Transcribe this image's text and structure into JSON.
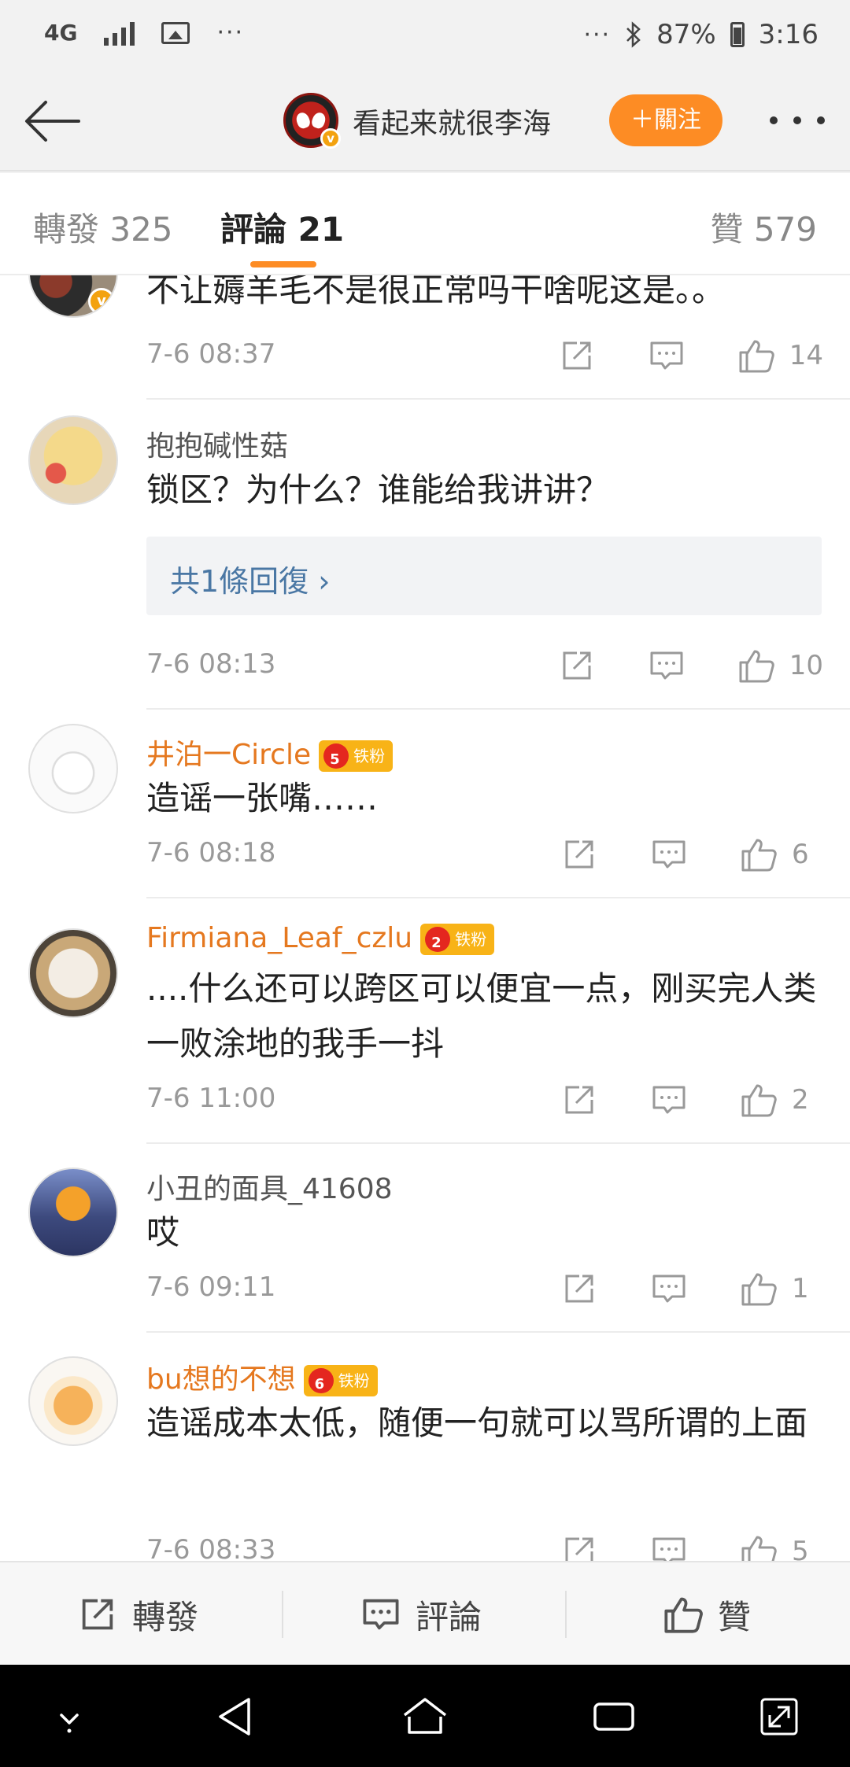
{
  "status_bar": {
    "network": "4G",
    "battery": "87%",
    "time": "3:16",
    "dots": "···"
  },
  "header": {
    "title": "看起来就很李海",
    "follow_label": "＋關注"
  },
  "tabs": [
    {
      "label": "轉發 325"
    },
    {
      "label": "評論 21"
    },
    {
      "label": "贊 579"
    }
  ],
  "comments": [
    {
      "text": "不让薅羊毛不是很正常吗干啥呢这是。。",
      "time": "7-6 08:37",
      "likes": "14"
    },
    {
      "name": "抱抱碱性菇",
      "text": "锁区？为什么？谁能给我讲讲？",
      "reply": "共1條回復 ›",
      "time": "7-6 08:13",
      "likes": "10"
    },
    {
      "name": "井泊一Circle",
      "badge": "铁粉",
      "badge_level": "5",
      "text": "造谣一张嘴……",
      "time": "7-6 08:18",
      "likes": "6"
    },
    {
      "name": "Firmiana_Leaf_czlu",
      "badge": "铁粉",
      "badge_level": "2",
      "text": "....什么还可以跨区可以便宜一点，刚买完人类一败涂地的我手一抖",
      "time": "7-6 11:00",
      "likes": "2"
    },
    {
      "name": "小丑的面具_41608",
      "text": "哎",
      "time": "7-6 09:11",
      "likes": "1"
    },
    {
      "name": "bu想的不想",
      "badge": "铁粉",
      "badge_level": "6",
      "text": "造谣成本太低，随便一句就可以骂所谓的上面",
      "time": "7-6 08:33",
      "likes": "5"
    }
  ],
  "bottom_bar": {
    "repost": "轉發",
    "comment": "評論",
    "like": "贊"
  },
  "colors": {
    "accent": "#fd8c24",
    "name_orange": "#e5781f",
    "reply_link": "#4a77a4",
    "fan_badge": "#f8b317"
  }
}
